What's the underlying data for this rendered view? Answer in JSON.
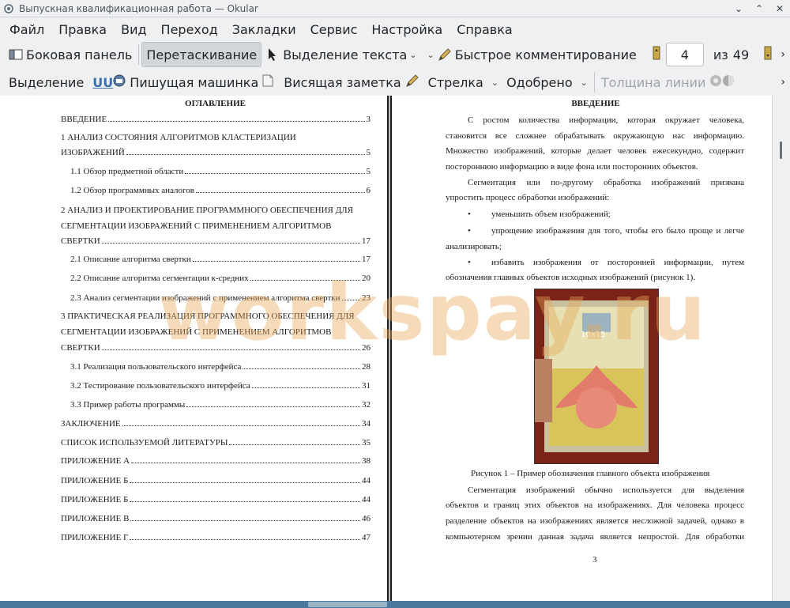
{
  "window": {
    "title": "Выпускная квалификационная работа — Okular"
  },
  "menubar": [
    "Файл",
    "Правка",
    "Вид",
    "Переход",
    "Закладки",
    "Сервис",
    "Настройка",
    "Справка"
  ],
  "toolbar1": {
    "sidebar": "Боковая панель",
    "drag": "Перетаскивание",
    "text_select": "Выделение текста",
    "quick_comment": "Быстрое комментирование",
    "page_current": "4",
    "page_of": "из",
    "page_total": "49"
  },
  "toolbar2": {
    "selection": "Выделение",
    "typewriter": "Пишущая машинка",
    "sticky_note": "Висящая заметка",
    "arrow": "Стрелка",
    "approved": "Одобрено",
    "line_width": "Толщина линии"
  },
  "left_page": {
    "title": "ОГЛАВЛЕНИЕ",
    "toc": [
      {
        "text": "ВВЕДЕНИЕ",
        "page": "3"
      },
      {
        "text": "1 АНАЛИЗ СОСТОЯНИЯ АЛГОРИТМОВ КЛАСТЕРИЗАЦИИ",
        "page": ""
      },
      {
        "text": "ИЗОБРАЖЕНИЙ",
        "page": "5"
      },
      {
        "text": "1.1 Обзор предметной области",
        "page": "5"
      },
      {
        "text": "1.2 Обзор программных аналогов",
        "page": "6"
      },
      {
        "text": "2 АНАЛИЗ И ПРОЕКТИРОВАНИЕ ПРОГРАММНОГО ОБЕСПЕЧЕНИЯ ДЛЯ",
        "page": ""
      },
      {
        "text": "СЕГМЕНТАЦИИ ИЗОБРАЖЕНИЙ С ПРИМЕНЕНИЕМ АЛГОРИТМОВ",
        "page": ""
      },
      {
        "text": "СВЕРТКИ",
        "page": "17"
      },
      {
        "text": "2.1 Описание алгоритма свертки",
        "page": "17"
      },
      {
        "text": "2.2 Описание алгоритма сегментации к-средних",
        "page": "20"
      },
      {
        "text": "2.3 Анализ сегментации изображений с применением алгоритма свертки",
        "page": "23"
      },
      {
        "text": "3 ПРАКТИЧЕСКАЯ РЕАЛИЗАЦИЯ ПРОГРАММНОГО ОБЕСПЕЧЕНИЯ ДЛЯ",
        "page": ""
      },
      {
        "text": "СЕГМЕНТАЦИИ ИЗОБРАЖЕНИЙ С ПРИМЕНЕНИЕМ АЛГОРИТМОВ",
        "page": ""
      },
      {
        "text": "СВЕРТКИ",
        "page": "26"
      },
      {
        "text": "3.1 Реализация пользовательского интерфейса",
        "page": "28"
      },
      {
        "text": "3.2 Тестирование пользовательского интерфейса",
        "page": "31"
      },
      {
        "text": "3.3 Пример работы программы",
        "page": "32"
      },
      {
        "text": "ЗАКЛЮЧЕНИЕ",
        "page": "34"
      },
      {
        "text": "СПИСОК ИСПОЛЬЗУЕМОЙ ЛИТЕРАТУРЫ",
        "page": "35"
      },
      {
        "text": "ПРИЛОЖЕНИЕ А",
        "page": "38"
      },
      {
        "text": "ПРИЛОЖЕНИЕ Б",
        "page": "44"
      },
      {
        "text": "ПРИЛОЖЕНИЕ Б",
        "page": "44"
      },
      {
        "text": "ПРИЛОЖЕНИЕ В",
        "page": "46"
      },
      {
        "text": "ПРИЛОЖЕНИЕ Г",
        "page": "47"
      }
    ]
  },
  "right_page": {
    "title": "ВВЕДЕНИЕ",
    "lines": [
      "С ростом количества информации, которая окружает человека,",
      "становится все сложнее обрабатывать окружающую нас информацию.",
      "Множество изображений, которые делает человек ежесекундно, содержит",
      "постороннюю информацию в виде фона или посторонних объектов.",
      "Сегментация или по-другому обработка изображений призвана",
      "упростить процесс обработки изображений:",
      "•",
      "уменьшить объем изображений;",
      "•",
      "упрощение изображения для того, чтобы его было проще и легче",
      "анализировать;",
      "•",
      "избавить изображения от посторонней информации, путем",
      "обозначения главных объектов исходных изображений (рисунок 1).",
      "Рисунок 1 – Пример обозначения главного объекта изображения",
      "Сегментация изображений обычно используется для выделения",
      "объектов и границ этих объектов на изображениях. Для человека процесс",
      "разделение объектов на изображениях является несложной задачей, однако в",
      "компьютерном зрении данная задача является непростой. Для обработки",
      "3"
    ],
    "photo_text": "10x15"
  },
  "watermark": "workspay.ru",
  "colors": {
    "accent": "#3daee9",
    "frame_red": "#7b2316",
    "watermark": "#e6aa5a"
  }
}
